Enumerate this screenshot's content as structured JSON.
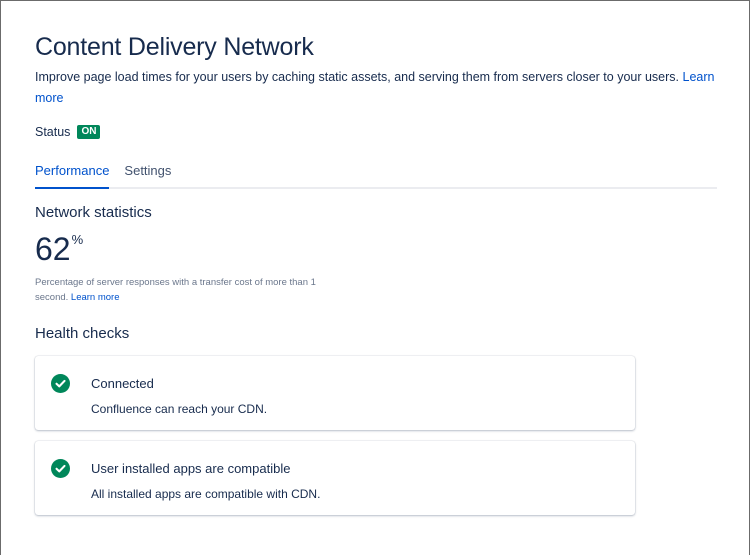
{
  "page": {
    "title": "Content Delivery Network",
    "description": "Improve page load times for your users by caching static assets, and serving them from servers closer to your users.",
    "learn_more": "Learn more"
  },
  "status": {
    "label": "Status",
    "badge": "ON",
    "badge_color": "#00875a"
  },
  "tabs": [
    {
      "label": "Performance",
      "active": true
    },
    {
      "label": "Settings",
      "active": false
    }
  ],
  "network": {
    "title": "Network statistics",
    "value": "62",
    "unit": "%",
    "description": "Percentage of server responses with a transfer cost of more than 1 second.",
    "learn_more": "Learn more"
  },
  "health": {
    "title": "Health checks",
    "checks": [
      {
        "icon": "check-circle-icon",
        "title": "Connected",
        "text": "Confluence can reach your CDN.",
        "color": "#00875a"
      },
      {
        "icon": "check-circle-icon",
        "title": "User installed apps are compatible",
        "text": "All installed apps are compatible with CDN.",
        "color": "#00875a"
      }
    ]
  },
  "colors": {
    "accent": "#0052cc",
    "text": "#172b4d",
    "success": "#00875a"
  }
}
